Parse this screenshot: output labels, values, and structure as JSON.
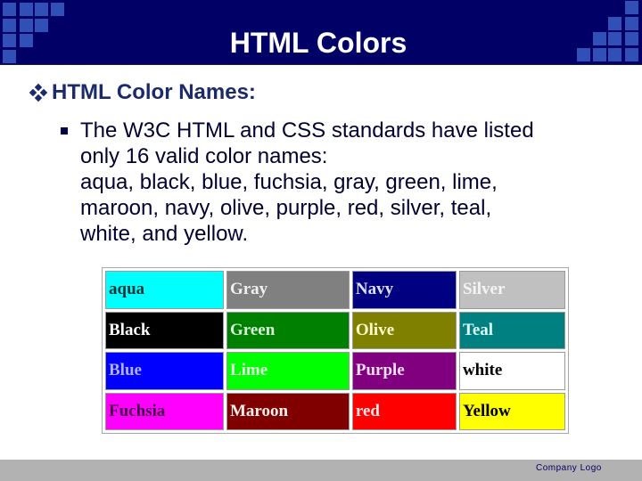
{
  "slide": {
    "title": "HTML Colors",
    "heading": "HTML Color Names:",
    "heading_icon": "diamond-bullet-icon",
    "bullet_icon": "square-bullet-icon",
    "bullet_text": "The W3C HTML and CSS standards have listed\nonly 16 valid color names:\naqua, black, blue, fuchsia, gray, green, lime,\nmaroon, navy, olive, purple, red, silver, teal,\nwhite, and yellow.",
    "footer_logo": "Company  Logo"
  },
  "theme": {
    "header_bg": "#000066",
    "decor_square": "#3050b8",
    "footer_bg": "#b2b2b2",
    "heading_color": "#1a2a6a"
  },
  "color_table": {
    "rows": [
      [
        {
          "label": "aqua",
          "bg": "#00ffff",
          "fg": "#003333"
        },
        {
          "label": "Gray",
          "bg": "#808080",
          "fg": "#f0f0f0"
        },
        {
          "label": "Navy",
          "bg": "#000080",
          "fg": "#e0e0ff"
        },
        {
          "label": "Silver",
          "bg": "#c0c0c0",
          "fg": "#f4f4f4"
        }
      ],
      [
        {
          "label": "Black",
          "bg": "#000000",
          "fg": "#ffffff"
        },
        {
          "label": "Green",
          "bg": "#008000",
          "fg": "#d8f0d8"
        },
        {
          "label": "Olive",
          "bg": "#808000",
          "fg": "#ffffcc"
        },
        {
          "label": "Teal",
          "bg": "#008080",
          "fg": "#e0ffff"
        }
      ],
      [
        {
          "label": "Blue",
          "bg": "#0000ff",
          "fg": "#b0b0ff"
        },
        {
          "label": "Lime",
          "bg": "#00ff00",
          "fg": "#e0ffe0"
        },
        {
          "label": "Purple",
          "bg": "#800080",
          "fg": "#ffe0ff"
        },
        {
          "label": "white",
          "bg": "#ffffff",
          "fg": "#000000"
        }
      ],
      [
        {
          "label": "Fuchsia",
          "bg": "#ff00ff",
          "fg": "#400040"
        },
        {
          "label": "Maroon",
          "bg": "#800000",
          "fg": "#fff0f0"
        },
        {
          "label": "red",
          "bg": "#ff0000",
          "fg": "#ffe8e8"
        },
        {
          "label": "Yellow",
          "bg": "#ffff00",
          "fg": "#000000"
        }
      ]
    ]
  }
}
